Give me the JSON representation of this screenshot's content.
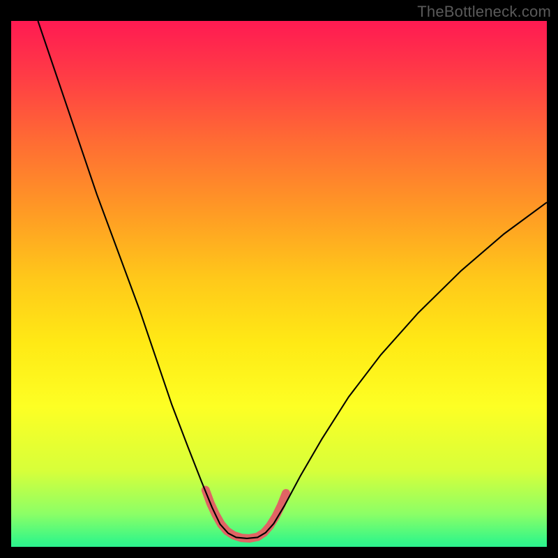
{
  "watermark": "TheBottleneck.com",
  "chart_data": {
    "type": "line",
    "title": "",
    "xlabel": "",
    "ylabel": "",
    "xlim": [
      0,
      100
    ],
    "ylim": [
      0,
      100
    ],
    "gradient_stops": [
      {
        "pos": 0.0,
        "color": "#ff1a52"
      },
      {
        "pos": 0.1,
        "color": "#ff3b46"
      },
      {
        "pos": 0.22,
        "color": "#ff6a34"
      },
      {
        "pos": 0.35,
        "color": "#ff9825"
      },
      {
        "pos": 0.48,
        "color": "#ffc81a"
      },
      {
        "pos": 0.6,
        "color": "#ffe915"
      },
      {
        "pos": 0.72,
        "color": "#fdff24"
      },
      {
        "pos": 0.84,
        "color": "#d7ff3a"
      },
      {
        "pos": 0.92,
        "color": "#8cff66"
      },
      {
        "pos": 0.97,
        "color": "#39f786"
      },
      {
        "pos": 1.0,
        "color": "#18e99b"
      }
    ],
    "series": [
      {
        "name": "bottleneck-curve",
        "stroke": "#000000",
        "stroke_width": 2.1,
        "points": [
          {
            "x": 5.0,
            "y": 100.0
          },
          {
            "x": 8.0,
            "y": 91.0
          },
          {
            "x": 12.0,
            "y": 79.0
          },
          {
            "x": 16.0,
            "y": 67.0
          },
          {
            "x": 20.0,
            "y": 56.0
          },
          {
            "x": 24.0,
            "y": 45.0
          },
          {
            "x": 27.0,
            "y": 36.0
          },
          {
            "x": 30.0,
            "y": 27.0
          },
          {
            "x": 33.0,
            "y": 19.0
          },
          {
            "x": 35.5,
            "y": 12.5
          },
          {
            "x": 37.5,
            "y": 7.5
          },
          {
            "x": 39.0,
            "y": 4.3
          },
          {
            "x": 40.5,
            "y": 2.6
          },
          {
            "x": 42.0,
            "y": 1.8
          },
          {
            "x": 44.0,
            "y": 1.6
          },
          {
            "x": 46.0,
            "y": 1.8
          },
          {
            "x": 47.5,
            "y": 2.7
          },
          {
            "x": 49.0,
            "y": 4.4
          },
          {
            "x": 51.0,
            "y": 7.8
          },
          {
            "x": 54.0,
            "y": 13.5
          },
          {
            "x": 58.0,
            "y": 20.5
          },
          {
            "x": 63.0,
            "y": 28.5
          },
          {
            "x": 69.0,
            "y": 36.5
          },
          {
            "x": 76.0,
            "y": 44.5
          },
          {
            "x": 84.0,
            "y": 52.5
          },
          {
            "x": 92.0,
            "y": 59.5
          },
          {
            "x": 100.0,
            "y": 65.5
          }
        ]
      },
      {
        "name": "highlight-band",
        "stroke": "#e06464",
        "stroke_width": 12,
        "linecap": "round",
        "points": [
          {
            "x": 36.3,
            "y": 10.8
          },
          {
            "x": 37.2,
            "y": 8.3
          },
          {
            "x": 38.2,
            "y": 6.1
          },
          {
            "x": 39.2,
            "y": 4.3
          },
          {
            "x": 40.3,
            "y": 3.0
          },
          {
            "x": 41.5,
            "y": 2.2
          },
          {
            "x": 43.0,
            "y": 1.7
          },
          {
            "x": 44.5,
            "y": 1.6
          },
          {
            "x": 46.0,
            "y": 1.9
          },
          {
            "x": 47.2,
            "y": 2.7
          },
          {
            "x": 48.3,
            "y": 4.0
          },
          {
            "x": 49.4,
            "y": 5.8
          },
          {
            "x": 50.4,
            "y": 7.9
          },
          {
            "x": 51.3,
            "y": 10.2
          }
        ]
      }
    ]
  }
}
